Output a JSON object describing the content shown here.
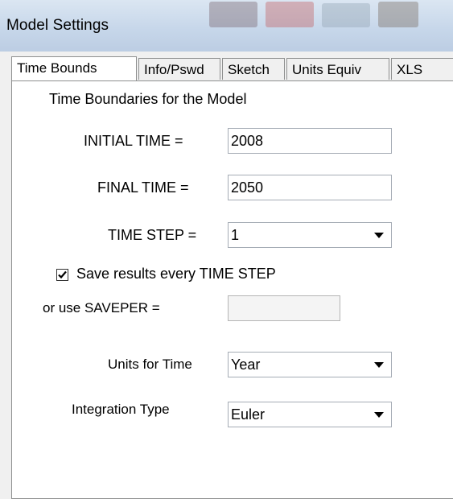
{
  "window": {
    "title": "Model Settings"
  },
  "tabs": [
    {
      "label": "Time Bounds",
      "active": true
    },
    {
      "label": "Info/Pswd",
      "active": false
    },
    {
      "label": "Sketch",
      "active": false
    },
    {
      "label": "Units Equiv",
      "active": false
    },
    {
      "label": "XLS",
      "active": false
    }
  ],
  "time_bounds": {
    "heading": "Time Boundaries for the Model",
    "initial_time": {
      "label": "INITIAL TIME =",
      "value": "2008"
    },
    "final_time": {
      "label": "FINAL TIME =",
      "value": "2050"
    },
    "time_step": {
      "label": "TIME STEP =",
      "value": "1"
    },
    "save_every": {
      "label": "Save results every TIME STEP",
      "checked": true
    },
    "saveper": {
      "label": "or use SAVEPER =",
      "value": ""
    },
    "units_for_time": {
      "label": "Units for Time",
      "value": "Year"
    },
    "integration_type": {
      "label": "Integration Type",
      "value": "Euler"
    }
  }
}
